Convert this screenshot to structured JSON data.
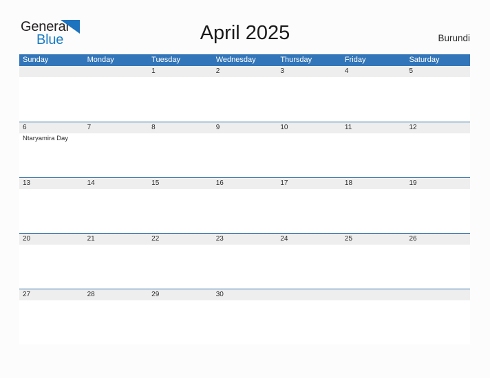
{
  "logo": {
    "word_top": "General",
    "word_bottom": "Blue",
    "flag_icon": "blue-triangle-flag-icon",
    "accent_color": "#1a7bc4"
  },
  "header": {
    "month_title": "April 2025",
    "country": "Burundi"
  },
  "theme": {
    "header_blue": "#3275b8",
    "divider_blue": "#2e6da4",
    "date_band_gray": "#eeeeee",
    "page_background": "#fcfcfc"
  },
  "calendar": {
    "weekdays": [
      "Sunday",
      "Monday",
      "Tuesday",
      "Wednesday",
      "Thursday",
      "Friday",
      "Saturday"
    ],
    "weeks": [
      {
        "days": [
          {
            "date": "",
            "events": []
          },
          {
            "date": "",
            "events": []
          },
          {
            "date": "1",
            "events": []
          },
          {
            "date": "2",
            "events": []
          },
          {
            "date": "3",
            "events": []
          },
          {
            "date": "4",
            "events": []
          },
          {
            "date": "5",
            "events": []
          }
        ]
      },
      {
        "days": [
          {
            "date": "6",
            "events": [
              "Ntaryamira Day"
            ]
          },
          {
            "date": "7",
            "events": []
          },
          {
            "date": "8",
            "events": []
          },
          {
            "date": "9",
            "events": []
          },
          {
            "date": "10",
            "events": []
          },
          {
            "date": "11",
            "events": []
          },
          {
            "date": "12",
            "events": []
          }
        ]
      },
      {
        "days": [
          {
            "date": "13",
            "events": []
          },
          {
            "date": "14",
            "events": []
          },
          {
            "date": "15",
            "events": []
          },
          {
            "date": "16",
            "events": []
          },
          {
            "date": "17",
            "events": []
          },
          {
            "date": "18",
            "events": []
          },
          {
            "date": "19",
            "events": []
          }
        ]
      },
      {
        "days": [
          {
            "date": "20",
            "events": []
          },
          {
            "date": "21",
            "events": []
          },
          {
            "date": "22",
            "events": []
          },
          {
            "date": "23",
            "events": []
          },
          {
            "date": "24",
            "events": []
          },
          {
            "date": "25",
            "events": []
          },
          {
            "date": "26",
            "events": []
          }
        ]
      },
      {
        "days": [
          {
            "date": "27",
            "events": []
          },
          {
            "date": "28",
            "events": []
          },
          {
            "date": "29",
            "events": []
          },
          {
            "date": "30",
            "events": []
          },
          {
            "date": "",
            "events": []
          },
          {
            "date": "",
            "events": []
          },
          {
            "date": "",
            "events": []
          }
        ]
      }
    ]
  }
}
